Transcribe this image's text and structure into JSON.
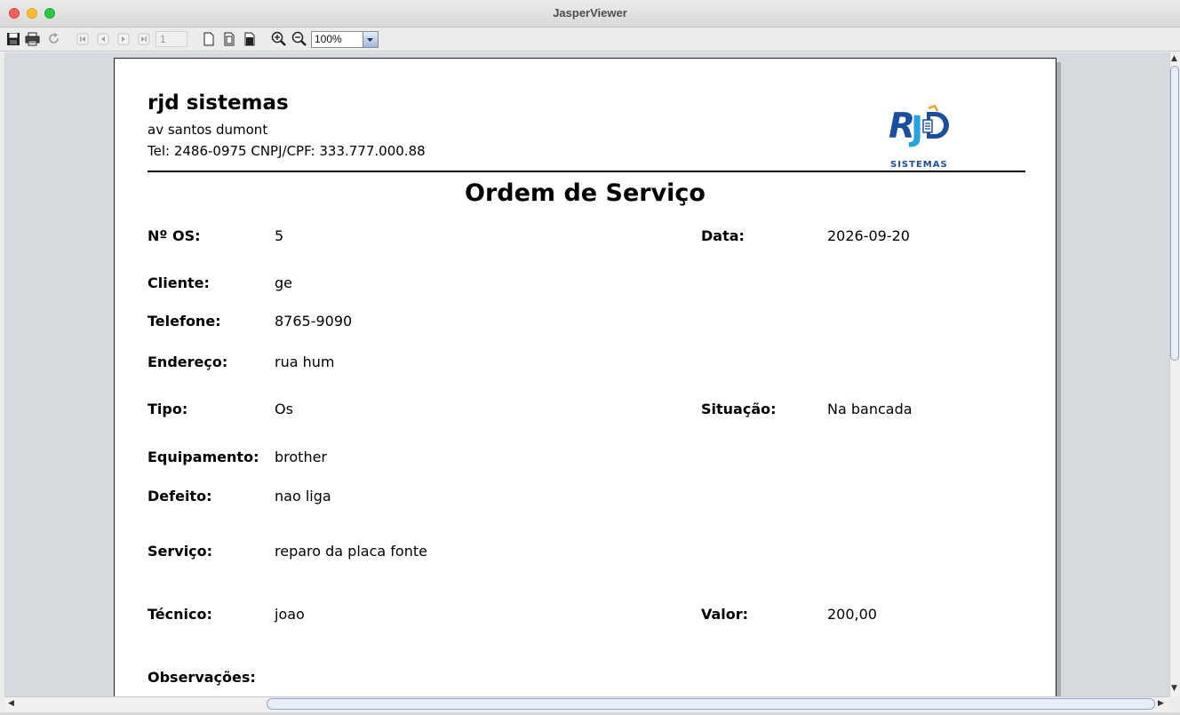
{
  "window": {
    "title": "JasperViewer"
  },
  "toolbar": {
    "page_number": "1",
    "zoom": "100%",
    "buttons": [
      {
        "name": "save",
        "icon": "floppy-icon"
      },
      {
        "name": "print",
        "icon": "printer-icon"
      },
      {
        "name": "reload",
        "icon": "reload-icon"
      },
      {
        "name": "first-page",
        "icon": "first-page-icon"
      },
      {
        "name": "previous-page",
        "icon": "previous-page-icon"
      },
      {
        "name": "next-page",
        "icon": "next-page-icon"
      },
      {
        "name": "last-page",
        "icon": "last-page-icon"
      },
      {
        "name": "actual-size",
        "icon": "page-actual-icon"
      },
      {
        "name": "fit-page",
        "icon": "page-fit-icon"
      },
      {
        "name": "fit-width",
        "icon": "page-width-icon"
      },
      {
        "name": "zoom-in",
        "icon": "zoom-in-icon"
      },
      {
        "name": "zoom-out",
        "icon": "zoom-out-icon"
      }
    ]
  },
  "report": {
    "company": "rjd sistemas",
    "address": "av santos dumont",
    "contact": "Tel: 2486-0975   CNPJ/CPF: 333.777.000.88",
    "logo_text": "SISTEMAS",
    "heading": "Ordem de Serviço",
    "fields": {
      "os_label": "Nº OS:",
      "os_value": "5",
      "data_label": "Data:",
      "data_value": "2026-09-20",
      "cliente_label": "Cliente:",
      "cliente_value": "ge",
      "telefone_label": "Telefone:",
      "telefone_value": "8765-9090",
      "endereco_label": "Endereço:",
      "endereco_value": "rua hum",
      "tipo_label": "Tipo:",
      "tipo_value": "Os",
      "situacao_label": "Situação:",
      "situacao_value": "Na bancada",
      "equipamento_label": "Equipamento:",
      "equipamento_value": "brother",
      "defeito_label": "Defeito:",
      "defeito_value": "nao liga",
      "servico_label": "Serviço:",
      "servico_value": "reparo da placa fonte",
      "tecnico_label": "Técnico:",
      "tecnico_value": "joao",
      "valor_label": "Valor:",
      "valor_value": "200,00",
      "observacoes_label": "Observações:"
    }
  },
  "colors": {
    "logo_blue": "#1a4fa0",
    "logo_cyan": "#29a3e0",
    "logo_orange": "#f0a020"
  }
}
